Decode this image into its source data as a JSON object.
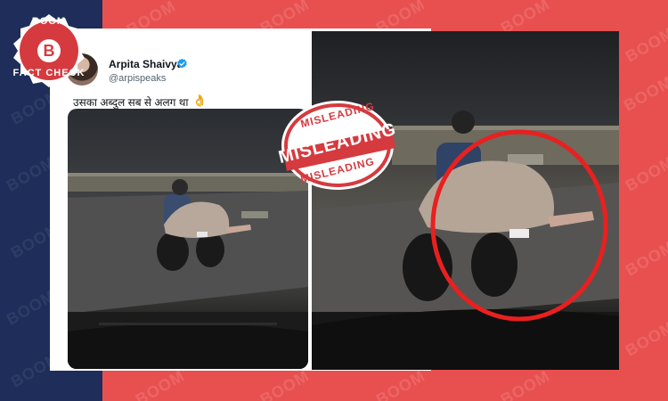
{
  "background": {
    "left_color": "#1f2d5a",
    "right_color": "#e8504f",
    "watermark_text": "BOOM"
  },
  "logo": {
    "top_text": "BOOM",
    "letter": "B",
    "bottom_text": "FACT CHECK"
  },
  "tweet": {
    "author_name": "Arpita Shaivya",
    "handle": "@arpispeaks",
    "text": "उसका अब्दुल सब से अलग था",
    "emoji": "👌",
    "more_label": "···",
    "verified_color": "#1d9bf0"
  },
  "stamp": {
    "top": "MISLEADING",
    "main": "MISLEADING",
    "bottom": "MISLEADING",
    "color": "#d53a3f"
  },
  "highlight": {
    "color": "#e8201f"
  }
}
